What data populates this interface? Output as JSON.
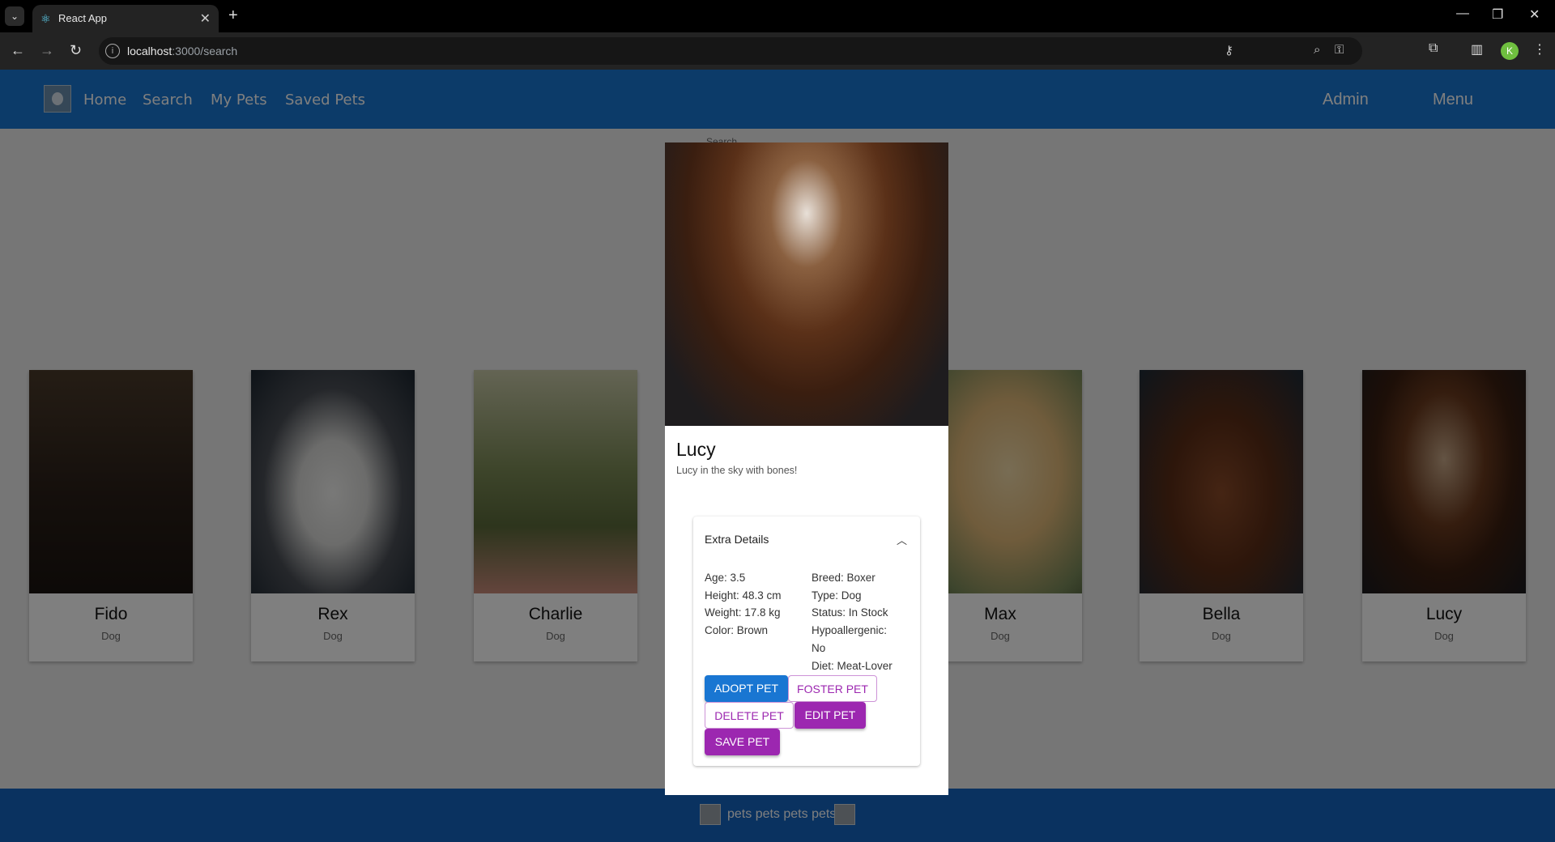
{
  "browser": {
    "tab_title": "React App",
    "url_host": "localhost",
    "url_path": ":3000/search",
    "profile_initial": "K"
  },
  "nav": {
    "links": [
      "Home",
      "Search",
      "My Pets",
      "Saved Pets"
    ],
    "admin": "Admin",
    "menu": "Menu"
  },
  "search_label": "Search",
  "cards": [
    {
      "name": "Fido",
      "type": "Dog"
    },
    {
      "name": "Rex",
      "type": "Dog"
    },
    {
      "name": "Charlie",
      "type": "Dog"
    },
    {
      "name": "Max",
      "type": "Dog"
    },
    {
      "name": "Bella",
      "type": "Dog"
    },
    {
      "name": "Lucy",
      "type": "Dog"
    }
  ],
  "modal": {
    "name": "Lucy",
    "description": "Lucy in the sky with bones!",
    "accordion_title": "Extra Details",
    "left": [
      "Age: 3.5",
      "Height: 48.3 cm",
      "Weight: 17.8 kg",
      "Color: Brown"
    ],
    "right": [
      "Breed: Boxer",
      "Type: Dog",
      "Status: In Stock",
      "Hypoallergenic:",
      "No",
      "Diet: Meat-Lover"
    ],
    "buttons": {
      "adopt": "ADOPT PET",
      "foster": "FOSTER PET",
      "delete": "DELETE PET",
      "edit": "EDIT PET",
      "save": "SAVE PET"
    }
  },
  "footer_text": "pets pets pets pets",
  "colors": {
    "appbar": "#1976d2",
    "footer": "#1565c0",
    "primary_button": "#1976d2",
    "secondary": "#9c27b0"
  }
}
